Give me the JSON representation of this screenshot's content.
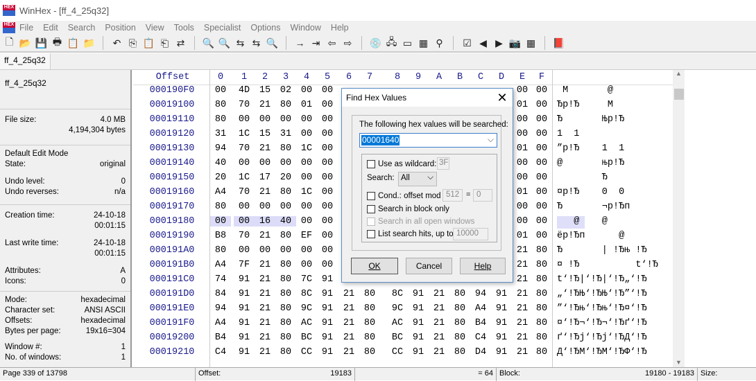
{
  "window": {
    "title": "WinHex - [ff_4_25q32]",
    "logo": "HEX"
  },
  "menu": [
    "File",
    "Edit",
    "Search",
    "Position",
    "View",
    "Tools",
    "Specialist",
    "Options",
    "Window",
    "Help"
  ],
  "toolbar": [
    [
      "new-file-icon",
      "🗋"
    ],
    [
      "open-icon",
      "📂"
    ],
    [
      "save-icon",
      "💾"
    ],
    [
      "print-icon",
      "🖶"
    ],
    [
      "properties-icon",
      "📋"
    ],
    [
      "open-folder-icon",
      "📁"
    ],
    "|",
    [
      "undo-icon",
      "↶"
    ],
    [
      "copy-icon",
      "⎘"
    ],
    [
      "paste-icon",
      "📋"
    ],
    [
      "paste-write-icon",
      "⎗"
    ],
    [
      "binary-convert-icon",
      "⇄"
    ],
    "|",
    [
      "find-text-icon",
      "🔍"
    ],
    [
      "find-hex-icon",
      "🔍"
    ],
    [
      "replace-text-icon",
      "⇆"
    ],
    [
      "replace-hex-icon",
      "⇆"
    ],
    [
      "find-again-icon",
      "🔍"
    ],
    "|",
    [
      "goto-offset-icon",
      "→"
    ],
    [
      "goto-page-icon",
      "⇥"
    ],
    [
      "back-icon",
      "⇦"
    ],
    [
      "forward-icon",
      "⇨"
    ],
    "|",
    [
      "disk-icon",
      "💿"
    ],
    [
      "ram-icon",
      "🖧"
    ],
    [
      "memory-icon",
      "▭"
    ],
    [
      "calculator-icon",
      "▦"
    ],
    [
      "search-icon",
      "⚲"
    ],
    "|",
    [
      "compare-icon",
      "☑"
    ],
    [
      "previous-icon",
      "◀"
    ],
    [
      "next-icon",
      "▶"
    ],
    [
      "snapshot-icon",
      "📷"
    ],
    [
      "table-icon",
      "▦"
    ],
    "|",
    [
      "help-book-icon",
      "📕"
    ]
  ],
  "tab": "ff_4_25q32",
  "info": {
    "filename": "ff_4_25q32",
    "file_size_label": "File size:",
    "file_size_mb": "4.0 MB",
    "file_size_bytes": "4,194,304 bytes",
    "edit_mode": "Default Edit Mode",
    "state_label": "State:",
    "state": "original",
    "undo_level_label": "Undo level:",
    "undo_level": "0",
    "undo_rev_label": "Undo reverses:",
    "undo_rev": "n/a",
    "creation_label": "Creation time:",
    "creation_date": "24-10-18",
    "creation_time": "00:01:15",
    "write_label": "Last write time:",
    "write_date": "24-10-18",
    "write_time": "00:01:15",
    "attr_label": "Attributes:",
    "attr": "A",
    "icons_label": "Icons:",
    "icons": "0",
    "mode_label": "Mode:",
    "mode": "hexadecimal",
    "charset_label": "Character set:",
    "charset": "ANSI ASCII",
    "offsets_label": "Offsets:",
    "offsets": "hexadecimal",
    "bpp_label": "Bytes per page:",
    "bpp": "19x16=304",
    "window_label": "Window #:",
    "window_no": "1",
    "windows_label": "No. of windows:",
    "windows": "1"
  },
  "hex": {
    "offset_header": "Offset",
    "columns": [
      "0",
      "1",
      "2",
      "3",
      "4",
      "5",
      "6",
      "7",
      "8",
      "9",
      "A",
      "B",
      "C",
      "D",
      "E",
      "F"
    ],
    "selection": {
      "row": "00019180",
      "bytes": [
        0,
        1,
        2,
        3
      ]
    },
    "rows": [
      {
        "offset": "000190F0",
        "bytes": [
          "00",
          "4D",
          "15",
          "02",
          "00",
          "00",
          "",
          "",
          "",
          "",
          "",
          "",
          "",
          "",
          "00",
          "00"
        ],
        "text": " M       @"
      },
      {
        "offset": "00019100",
        "bytes": [
          "80",
          "70",
          "21",
          "80",
          "01",
          "00",
          "",
          "",
          "",
          "",
          "",
          "",
          "",
          "",
          "01",
          "00"
        ],
        "text": "Ђp!Ђ     M"
      },
      {
        "offset": "00019110",
        "bytes": [
          "80",
          "00",
          "00",
          "00",
          "00",
          "00",
          "",
          "",
          "",
          "",
          "",
          "",
          "",
          "",
          "00",
          "00"
        ],
        "text": "Ђ       Њp!Ђ"
      },
      {
        "offset": "00019120",
        "bytes": [
          "31",
          "1C",
          "15",
          "31",
          "00",
          "00",
          "",
          "",
          "",
          "",
          "",
          "",
          "",
          "",
          "00",
          "00"
        ],
        "text": "1  1"
      },
      {
        "offset": "00019130",
        "bytes": [
          "94",
          "70",
          "21",
          "80",
          "1C",
          "00",
          "",
          "",
          "",
          "",
          "",
          "",
          "",
          "",
          "01",
          "00"
        ],
        "text": "”p!Ђ    1  1"
      },
      {
        "offset": "00019140",
        "bytes": [
          "40",
          "00",
          "00",
          "00",
          "00",
          "00",
          "",
          "",
          "",
          "",
          "",
          "",
          "",
          "",
          "00",
          "00"
        ],
        "text": "@       њp!Ђ"
      },
      {
        "offset": "00019150",
        "bytes": [
          "20",
          "1C",
          "17",
          "20",
          "00",
          "00",
          "",
          "",
          "",
          "",
          "",
          "",
          "",
          "",
          "00",
          "00"
        ],
        "text": "        Ђ"
      },
      {
        "offset": "00019160",
        "bytes": [
          "A4",
          "70",
          "21",
          "80",
          "1C",
          "00",
          "",
          "",
          "",
          "",
          "",
          "",
          "",
          "",
          "01",
          "00"
        ],
        "text": "¤p!Ђ    0  0"
      },
      {
        "offset": "00019170",
        "bytes": [
          "80",
          "00",
          "00",
          "00",
          "00",
          "00",
          "",
          "",
          "",
          "",
          "",
          "",
          "",
          "",
          "00",
          "00"
        ],
        "text": "Ђ       ¬p!Ђп"
      },
      {
        "offset": "00019180",
        "bytes": [
          "00",
          "00",
          "16",
          "40",
          "00",
          "00",
          "",
          "",
          "",
          "",
          "",
          "",
          "",
          "",
          "00",
          "00"
        ],
        "text": "   @    @"
      },
      {
        "offset": "00019190",
        "bytes": [
          "B8",
          "70",
          "21",
          "80",
          "EF",
          "00",
          "",
          "",
          "",
          "",
          "",
          "",
          "",
          "",
          "01",
          "00"
        ],
        "text": "ёp!Ђп      @"
      },
      {
        "offset": "000191A0",
        "bytes": [
          "80",
          "00",
          "00",
          "00",
          "00",
          "00",
          "",
          "",
          "",
          "",
          "",
          "",
          "",
          "",
          "21",
          "80"
        ],
        "text": "Ђ       | !Ђњ !Ђ"
      },
      {
        "offset": "000191B0",
        "bytes": [
          "A4",
          "7F",
          "21",
          "80",
          "00",
          "00",
          "",
          "",
          "",
          "",
          "",
          "",
          "",
          "",
          "21",
          "80"
        ],
        "text": "¤ !Ђ          t‘!Ђ"
      },
      {
        "offset": "000191C0",
        "bytes": [
          "74",
          "91",
          "21",
          "80",
          "7C",
          "91",
          "21",
          "80",
          "7C",
          "91",
          "21",
          "80",
          "84",
          "91",
          "21",
          "80"
        ],
        "text": "t‘!Ђ|‘!Ђ|‘!Ђ„‘!Ђ"
      },
      {
        "offset": "000191D0",
        "bytes": [
          "84",
          "91",
          "21",
          "80",
          "8C",
          "91",
          "21",
          "80",
          "8C",
          "91",
          "21",
          "80",
          "94",
          "91",
          "21",
          "80"
        ],
        "text": "„‘!ЂЊ‘!ЂЊ‘!Ђ”‘!Ђ"
      },
      {
        "offset": "000191E0",
        "bytes": [
          "94",
          "91",
          "21",
          "80",
          "9C",
          "91",
          "21",
          "80",
          "9C",
          "91",
          "21",
          "80",
          "A4",
          "91",
          "21",
          "80"
        ],
        "text": "”‘!Ђњ‘!Ђњ‘!Ђ¤‘!Ђ"
      },
      {
        "offset": "000191F0",
        "bytes": [
          "A4",
          "91",
          "21",
          "80",
          "AC",
          "91",
          "21",
          "80",
          "AC",
          "91",
          "21",
          "80",
          "B4",
          "91",
          "21",
          "80"
        ],
        "text": "¤‘!Ђ¬‘!Ђ¬‘!Ђґ‘!Ђ"
      },
      {
        "offset": "00019200",
        "bytes": [
          "B4",
          "91",
          "21",
          "80",
          "BC",
          "91",
          "21",
          "80",
          "BC",
          "91",
          "21",
          "80",
          "C4",
          "91",
          "21",
          "80"
        ],
        "text": "ґ‘!Ђј‘!Ђј‘!ЂД‘!Ђ"
      },
      {
        "offset": "00019210",
        "bytes": [
          "C4",
          "91",
          "21",
          "80",
          "CC",
          "91",
          "21",
          "80",
          "CC",
          "91",
          "21",
          "80",
          "D4",
          "91",
          "21",
          "80"
        ],
        "text": "Д‘!ЂМ‘!ЂМ‘!ЂФ‘!Ђ"
      }
    ]
  },
  "status": {
    "page": "Page 339 of 13798",
    "offset_label": "Offset:",
    "offset": "19183",
    "value": "= 64",
    "block_label": "Block:",
    "block": "19180 - 19183",
    "size_label": "Size:"
  },
  "dialog": {
    "title": "Find Hex Values",
    "prompt": "The following hex values will be searched:",
    "value": "00001640",
    "wildcard_label": "Use as wildcard:",
    "wildcard": "3F",
    "search_label": "Search:",
    "search_value": "All",
    "cond_label": "Cond.: offset mod",
    "cond_mod": "512",
    "cond_eq": "=",
    "cond_val": "0",
    "block_only": "Search in block only",
    "all_windows": "Search in all open windows",
    "list_hits": "List search hits, up to ³",
    "list_max": "10000",
    "ok": "OK",
    "cancel": "Cancel",
    "help": "Help"
  }
}
